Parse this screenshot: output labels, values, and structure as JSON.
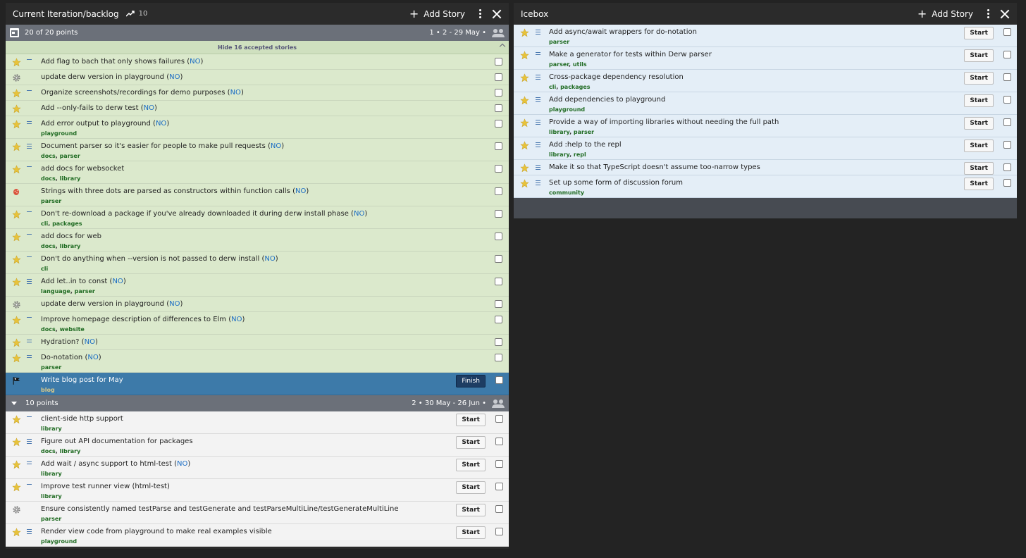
{
  "current": {
    "title": "Current Iteration/backlog",
    "velocity": "10",
    "add_story": "Add Story",
    "iteration1": {
      "points": "20 of 20 points",
      "dates": "1 • 2 - 29 May •",
      "hide_label": "Hide 16 accepted stories"
    },
    "accepted": [
      {
        "type": "feature",
        "est": 1,
        "title": "Add flag to bach that only shows failures",
        "no": "NO",
        "labels": []
      },
      {
        "type": "chore",
        "est": 0,
        "title": "update derw version in playground",
        "no": "NO",
        "labels": []
      },
      {
        "type": "feature",
        "est": 1,
        "title": "Organize screenshots/recordings for demo purposes",
        "no": "NO",
        "labels": []
      },
      {
        "type": "feature",
        "est": 0,
        "title": "Add --only-fails to derw test",
        "no": "NO",
        "labels": []
      },
      {
        "type": "feature",
        "est": 2,
        "title": "Add error output to playground",
        "no": "NO",
        "labels": [
          "playground"
        ]
      },
      {
        "type": "feature",
        "est": 3,
        "title": "Document parser so it's easier for people to make pull requests",
        "no": "NO",
        "labels": [
          "docs",
          "parser"
        ]
      },
      {
        "type": "feature",
        "est": 1,
        "title": "add docs for websocket",
        "no": "",
        "labels": [
          "docs",
          "library"
        ]
      },
      {
        "type": "bug",
        "est": 0,
        "title": "Strings with three dots are parsed as constructors within function calls",
        "no": "NO",
        "labels": [
          "parser"
        ]
      },
      {
        "type": "feature",
        "est": 1,
        "title": "Don't re-download a package if you've already downloaded it during derw install phase",
        "no": "NO",
        "labels": [
          "cli",
          "packages"
        ]
      },
      {
        "type": "feature",
        "est": 1,
        "title": "add docs for web",
        "no": "",
        "labels": [
          "docs",
          "library"
        ]
      },
      {
        "type": "feature",
        "est": 1,
        "title": "Don't do anything when --version is not passed to derw install",
        "no": "NO",
        "labels": [
          "cli"
        ]
      },
      {
        "type": "feature",
        "est": 3,
        "title": "Add let..in to const",
        "no": "NO",
        "labels": [
          "language",
          "parser"
        ]
      },
      {
        "type": "chore",
        "est": 0,
        "title": "update derw version in playground",
        "no": "NO",
        "labels": []
      },
      {
        "type": "feature",
        "est": 1,
        "title": "Improve homepage description of differences to Elm",
        "no": "NO",
        "labels": [
          "docs",
          "website"
        ]
      },
      {
        "type": "feature",
        "est": 2,
        "title": "Hydration?",
        "no": "NO",
        "labels": []
      },
      {
        "type": "feature",
        "est": 2,
        "title": "Do-notation",
        "no": "NO",
        "labels": [
          "parser"
        ]
      }
    ],
    "started": {
      "type": "release",
      "title": "Write blog post for May",
      "labels": [
        "blog"
      ],
      "button": "Finish"
    },
    "iteration2": {
      "points": "10 points",
      "dates": "2 • 30 May - 26 Jun •"
    },
    "backlog": [
      {
        "type": "feature",
        "est": 1,
        "title": "client-side http support",
        "no": "",
        "labels": [
          "library"
        ],
        "button": "Start"
      },
      {
        "type": "feature",
        "est": 3,
        "title": "Figure out API documentation for packages",
        "no": "",
        "labels": [
          "docs",
          "library"
        ],
        "button": "Start"
      },
      {
        "type": "feature",
        "est": 2,
        "title": "Add wait / async support to html-test",
        "no": "NO",
        "labels": [
          "library"
        ],
        "button": "Start"
      },
      {
        "type": "feature",
        "est": 1,
        "title": "Improve test runner view (html-test)",
        "no": "",
        "labels": [
          "library"
        ],
        "button": "Start"
      },
      {
        "type": "chore",
        "est": 0,
        "title": "Ensure consistently named testParse and testGenerate and testParseMultiLine/testGenerateMultiLine",
        "no": "",
        "labels": [
          "parser"
        ],
        "button": "Start"
      },
      {
        "type": "feature",
        "est": 3,
        "title": "Render view code from playground to make real examples visible",
        "no": "",
        "labels": [
          "playground"
        ],
        "button": "Start"
      }
    ]
  },
  "icebox": {
    "title": "Icebox",
    "add_story": "Add Story",
    "stories": [
      {
        "type": "feature",
        "est": 3,
        "title": "Add async/await wrappers for do-notation",
        "labels": [
          "parser"
        ],
        "button": "Start"
      },
      {
        "type": "feature",
        "est": 2,
        "title": "Make a generator for tests within Derw parser",
        "labels": [
          "parser",
          "utils"
        ],
        "button": "Start"
      },
      {
        "type": "feature",
        "est": 3,
        "title": "Cross-package dependency resolution",
        "labels": [
          "cli",
          "packages"
        ],
        "button": "Start"
      },
      {
        "type": "feature",
        "est": 3,
        "title": "Add dependencies to playground",
        "labels": [
          "playground"
        ],
        "button": "Start"
      },
      {
        "type": "feature",
        "est": 3,
        "title": "Provide a way of importing libraries without needing the full path",
        "labels": [
          "library",
          "parser"
        ],
        "button": "Start"
      },
      {
        "type": "feature",
        "est": 3,
        "title": "Add :help to the repl",
        "labels": [
          "library",
          "repl"
        ],
        "button": "Start"
      },
      {
        "type": "feature",
        "est": 3,
        "title": "Make it so that TypeScript doesn't assume too-narrow types",
        "labels": [],
        "button": "Start"
      },
      {
        "type": "feature",
        "est": 3,
        "title": "Set up some form of discussion forum",
        "labels": [
          "community"
        ],
        "button": "Start"
      }
    ]
  },
  "colors": {
    "accepted": "#dbe9cc",
    "started": "#3d7aa9",
    "icebox": "#e4eef7",
    "star": "#e8c33a"
  }
}
